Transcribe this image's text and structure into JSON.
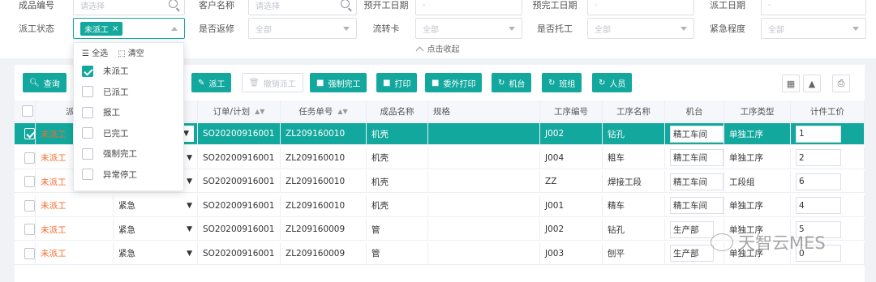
{
  "filters": {
    "row1": [
      {
        "label": "成品编号",
        "placeholder": "请选择",
        "icon": "search-icon"
      },
      {
        "label": "客户名称",
        "placeholder": "请选择",
        "icon": "search-icon"
      },
      {
        "label": "预开工日期",
        "placeholder": "-"
      },
      {
        "label": "预完工日期",
        "placeholder": "-"
      },
      {
        "label": "派工日期",
        "placeholder": "-"
      }
    ],
    "row2": [
      {
        "label": "派工状态",
        "tag": "未派工",
        "tag_close": "×"
      },
      {
        "label": "是否返修",
        "value": "全部"
      },
      {
        "label": "流转卡",
        "value": "全部"
      },
      {
        "label": "是否托工",
        "value": "全部"
      },
      {
        "label": "紧急程度",
        "value": "全部"
      }
    ],
    "collapse_label": "点击收起"
  },
  "status_dropdown": {
    "select_all": "全选",
    "clear": "清空",
    "options": [
      {
        "label": "未派工",
        "checked": true
      },
      {
        "label": "已派工",
        "checked": false
      },
      {
        "label": "报工",
        "checked": false
      },
      {
        "label": "已完工",
        "checked": false
      },
      {
        "label": "强制完工",
        "checked": false
      },
      {
        "label": "异常停工",
        "checked": false
      }
    ]
  },
  "toolbar": {
    "query": "查询",
    "dispatch": "派工",
    "cancel_dispatch": "撤销派工",
    "force_complete": "强制完工",
    "print": "打印",
    "outsource_print": "委外打印",
    "machine": "机台",
    "team": "班组",
    "staff": "人员"
  },
  "table": {
    "headers": [
      "派工",
      "",
      "订单/计划",
      "任务单号",
      "成品名称",
      "规格",
      "工序编号",
      "工序名称",
      "机台",
      "工序类型",
      "计件工价"
    ],
    "rows": [
      {
        "status": "未派工",
        "urgency": "",
        "order": "SO20200916001",
        "task": "ZL209160010",
        "product": "机壳",
        "spec": "",
        "proc_no": "J002",
        "proc_name": "钻孔",
        "machine": "精工车间",
        "proc_type": "单独工序",
        "price": "1",
        "selected": true
      },
      {
        "status": "未派工",
        "urgency": "",
        "order": "SO20200916001",
        "task": "ZL209160010",
        "product": "机壳",
        "spec": "",
        "proc_no": "J004",
        "proc_name": "粗车",
        "machine": "精工车间",
        "proc_type": "单独工序",
        "price": "2",
        "selected": false
      },
      {
        "status": "未派工",
        "urgency": "",
        "order": "SO20200916001",
        "task": "ZL209160010",
        "product": "机壳",
        "spec": "",
        "proc_no": "ZZ",
        "proc_name": "焊接工段",
        "machine": "精工车间",
        "proc_type": "工段组",
        "price": "6",
        "selected": false
      },
      {
        "status": "未派工",
        "urgency": "紧急",
        "order": "SO20200916001",
        "task": "ZL209160010",
        "product": "机壳",
        "spec": "",
        "proc_no": "J001",
        "proc_name": "精车",
        "machine": "精工车间",
        "proc_type": "单独工序",
        "price": "4",
        "selected": false
      },
      {
        "status": "未派工",
        "urgency": "紧急",
        "order": "SO20200916001",
        "task": "ZL209160009",
        "product": "管",
        "spec": "",
        "proc_no": "J002",
        "proc_name": "钻孔",
        "machine": "生产部",
        "proc_type": "单独工序",
        "price": "5",
        "selected": false
      },
      {
        "status": "未派工",
        "urgency": "紧急",
        "order": "SO20200916001",
        "task": "ZL209160009",
        "product": "管",
        "spec": "",
        "proc_no": "J003",
        "proc_name": "刨平",
        "machine": "生产部",
        "proc_type": "单独工序",
        "price": "0",
        "selected": false
      }
    ]
  },
  "watermark": "天智云MES",
  "accent_color": "#13a89e",
  "status_color": "#f56c2d"
}
